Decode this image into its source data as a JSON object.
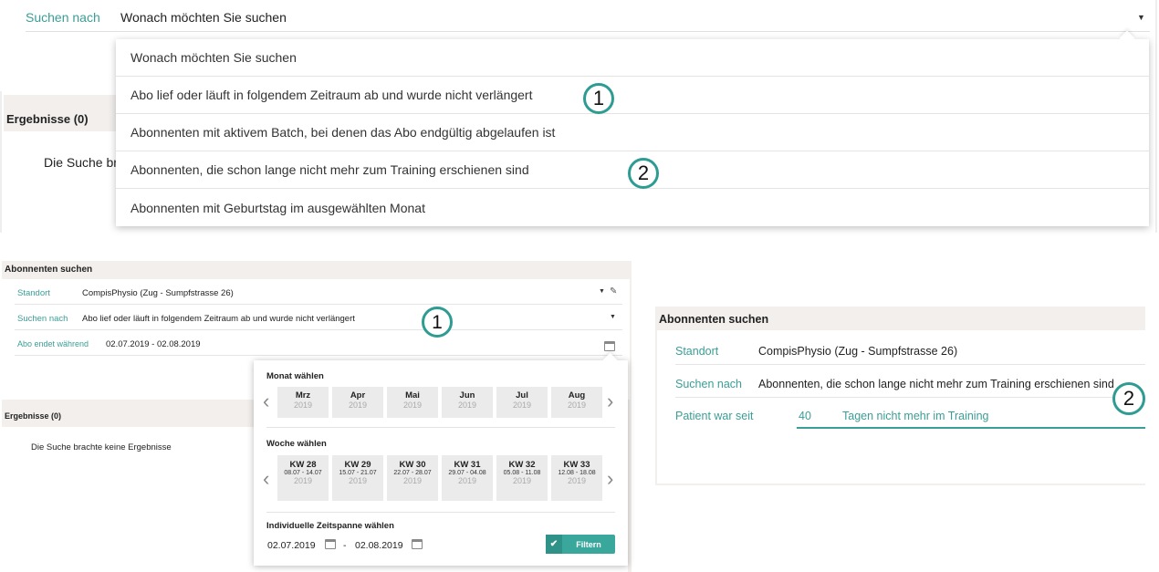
{
  "panel1": {
    "search_label": "Suchen nach",
    "search_value": "Wonach möchten Sie suchen",
    "results_label": "Ergebnisse (0)",
    "empty_text": "Die Suche br",
    "options": [
      "Wonach möchten Sie suchen",
      "Abo lief oder läuft in folgendem Zeitraum ab und wurde nicht verlängert",
      "Abonnenten mit aktivem Batch, bei denen das Abo endgültig abgelaufen ist",
      "Abonnenten, die schon lange nicht mehr zum Training erschienen sind",
      "Abonnenten mit Geburtstag im ausgewählten Monat"
    ],
    "marker1": "1",
    "marker2": "2"
  },
  "panel2": {
    "title": "Abonnenten suchen",
    "standort_label": "Standort",
    "standort_value": "CompisPhysio (Zug - Sumpfstrasse 26)",
    "search_label": "Suchen nach",
    "search_value": "Abo lief oder läuft in folgendem Zeitraum ab und wurde nicht verlängert",
    "abo_label": "Abo endet während",
    "abo_value": "02.07.2019 - 02.08.2019",
    "results_label": "Ergebnisse (0)",
    "empty_text": "Die Suche brachte keine Ergebnisse",
    "marker": "1",
    "popup": {
      "month_heading": "Monat wählen",
      "months": [
        {
          "name": "Mrz",
          "year": "2019"
        },
        {
          "name": "Apr",
          "year": "2019"
        },
        {
          "name": "Mai",
          "year": "2019"
        },
        {
          "name": "Jun",
          "year": "2019"
        },
        {
          "name": "Jul",
          "year": "2019"
        },
        {
          "name": "Aug",
          "year": "2019"
        }
      ],
      "week_heading": "Woche wählen",
      "weeks": [
        {
          "name": "KW 28",
          "range": "08.07 - 14.07",
          "year": "2019"
        },
        {
          "name": "KW 29",
          "range": "15.07 - 21.07",
          "year": "2019"
        },
        {
          "name": "KW 30",
          "range": "22.07 - 28.07",
          "year": "2019"
        },
        {
          "name": "KW 31",
          "range": "29.07 - 04.08",
          "year": "2019"
        },
        {
          "name": "KW 32",
          "range": "05.08 - 11.08",
          "year": "2019"
        },
        {
          "name": "KW 33",
          "range": "12.08 - 18.08",
          "year": "2019"
        }
      ],
      "custom_heading": "Individuelle Zeitspanne wählen",
      "from_date": "02.07.2019",
      "separator": "-",
      "to_date": "02.08.2019",
      "filter_label": "Filtern"
    }
  },
  "panel3": {
    "title": "Abonnenten suchen",
    "standort_label": "Standort",
    "standort_value": "CompisPhysio (Zug - Sumpfstrasse 26)",
    "search_label": "Suchen nach",
    "search_value": "Abonnenten, die schon lange nicht mehr zum Training erschienen sind",
    "patient_label": "Patient war seit",
    "days_value": "40",
    "days_suffix": "Tagen nicht mehr im Training",
    "marker": "2"
  },
  "colors": {
    "accent": "#3a9e96",
    "marker_ring": "#2e9c93",
    "panel_bar": "#f2efed",
    "button": "#3aa79c"
  }
}
